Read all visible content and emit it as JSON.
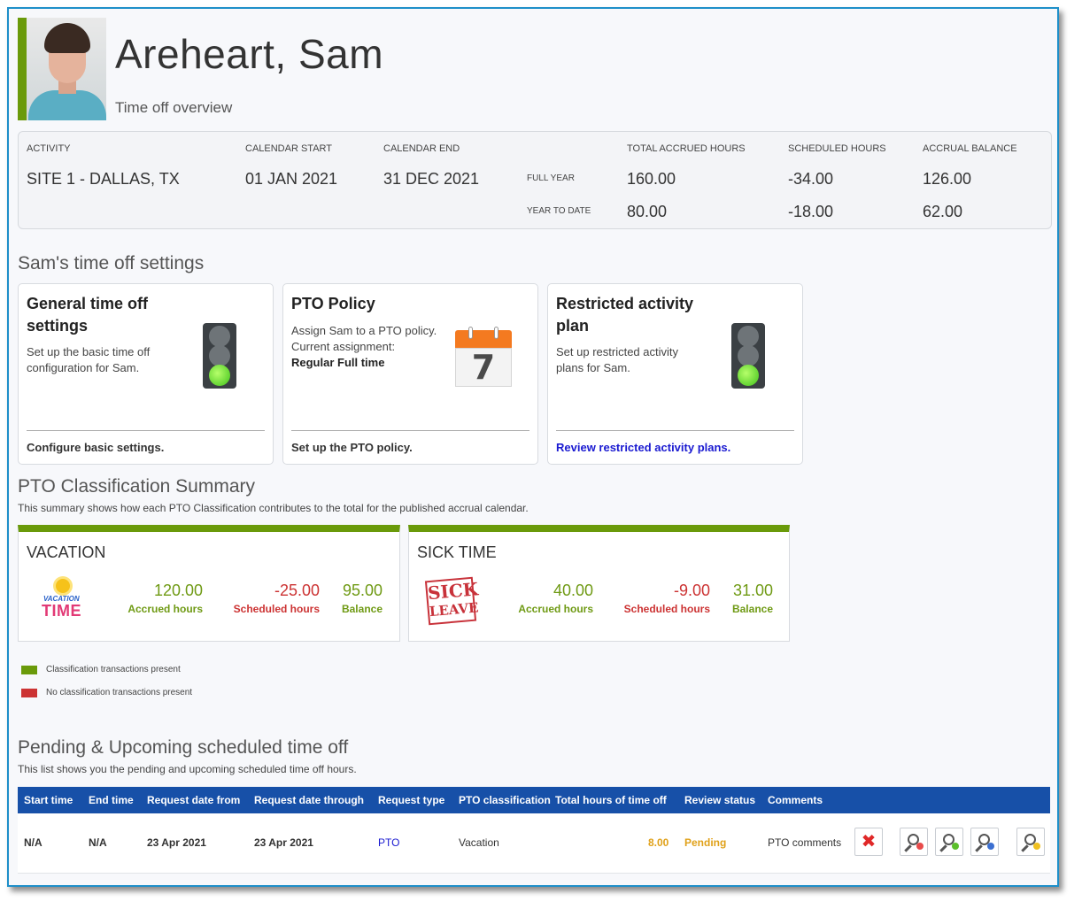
{
  "header": {
    "name": "Areheart, Sam",
    "subtitle": "Time off overview"
  },
  "accrual": {
    "labels": {
      "activity": "ACTIVITY",
      "calendar_start": "CALENDAR START",
      "calendar_end": "CALENDAR END",
      "total_accrued": "TOTAL ACCRUED HOURS",
      "scheduled": "SCHEDULED HOURS",
      "balance": "ACCRUAL BALANCE"
    },
    "activity": "SITE 1 - DALLAS, TX",
    "calendar_start": "01 JAN 2021",
    "calendar_end": "31 DEC 2021",
    "rows": [
      {
        "label": "FULL YEAR",
        "accrued": "160.00",
        "scheduled": "-34.00",
        "balance": "126.00"
      },
      {
        "label": "YEAR TO DATE",
        "accrued": "80.00",
        "scheduled": "-18.00",
        "balance": "62.00"
      }
    ]
  },
  "settings": {
    "heading": "Sam's time off settings",
    "cards": [
      {
        "title": "General time off settings",
        "text": "Set up the basic time off configuration for Sam.",
        "link": "Configure basic settings.",
        "icon": "traffic-light-icon"
      },
      {
        "title": "PTO Policy",
        "text": "Assign Sam to a PTO policy. Current assignment:",
        "assignment": "Regular Full time",
        "link": "Set up the PTO policy.",
        "icon": "calendar-icon",
        "calendar_day": "7"
      },
      {
        "title": "Restricted activity plan",
        "text": "Set up restricted activity plans for Sam.",
        "link": "Review restricted activity plans.",
        "icon": "traffic-light-icon"
      }
    ]
  },
  "classification": {
    "heading": "PTO Classification Summary",
    "description": "This summary shows how each PTO Classification contributes to the total for the published accrual calendar.",
    "cards": [
      {
        "title": "VACATION",
        "logo_text_1": "VACATION",
        "logo_text_2": "TIME",
        "accrued": "120.00",
        "accrued_label": "Accrued hours",
        "scheduled": "-25.00",
        "scheduled_label": "Scheduled hours",
        "balance": "95.00",
        "balance_label": "Balance"
      },
      {
        "title": "SICK TIME",
        "logo_text_1": "SICK",
        "logo_text_2": "LEAVE",
        "accrued": "40.00",
        "accrued_label": "Accrued hours",
        "scheduled": "-9.00",
        "scheduled_label": "Scheduled hours",
        "balance": "31.00",
        "balance_label": "Balance"
      }
    ],
    "legend": [
      {
        "label": "Classification transactions present",
        "color": "#6a9a0a"
      },
      {
        "label": "No classification transactions present",
        "color": "#cc3333"
      }
    ]
  },
  "pending": {
    "heading": "Pending & Upcoming scheduled time off",
    "description": "This list shows you the pending and upcoming scheduled time off hours.",
    "columns": [
      "Start time",
      "End time",
      "Request date from",
      "Request date through",
      "Request type",
      "PTO classification",
      "Total hours of time off",
      "Review status",
      "Comments"
    ],
    "rows": [
      {
        "start": "N/A",
        "end": "N/A",
        "from": "23 Apr 2021",
        "through": "23 Apr 2021",
        "type": "PTO",
        "classification": "Vacation",
        "hours": "8.00",
        "status": "Pending",
        "comments": "PTO comments"
      }
    ]
  },
  "colors": {
    "accent_green": "#6a9a0a",
    "negative_red": "#cc3333",
    "table_header_blue": "#1750a8",
    "pending_orange": "#e0a11a",
    "frame_border": "#1e8fc9"
  }
}
